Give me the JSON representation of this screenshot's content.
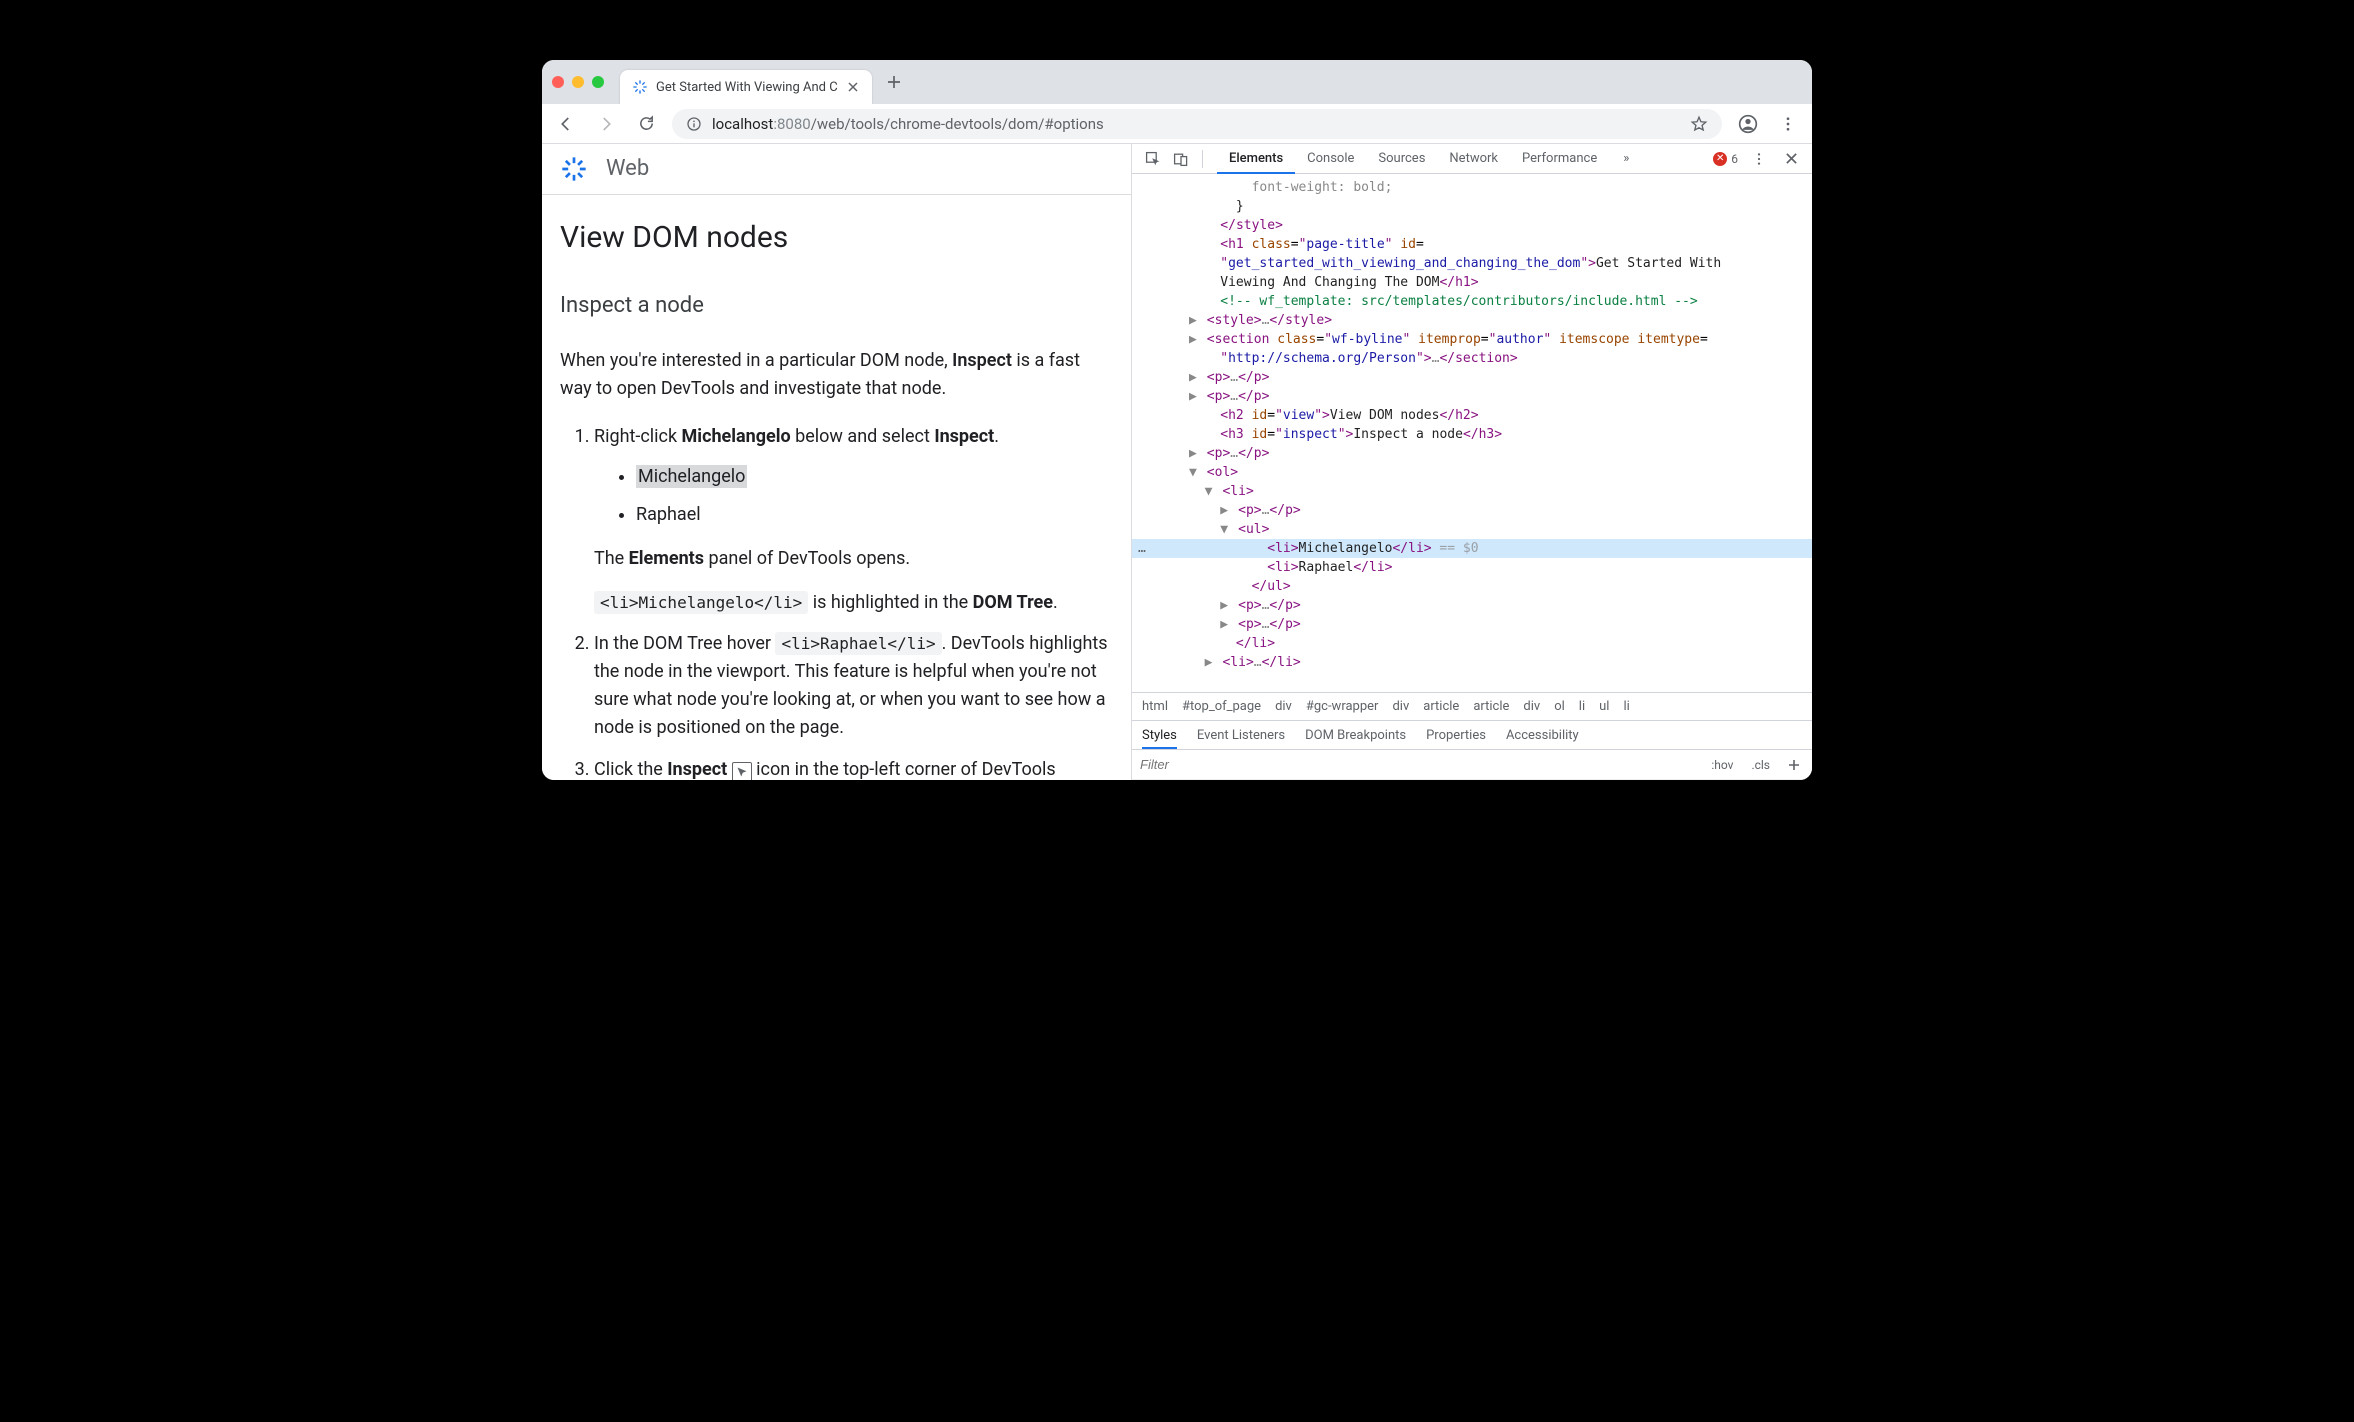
{
  "tab": {
    "title": "Get Started With Viewing And C"
  },
  "url": {
    "scheme_host": "localhost",
    "port": ":8080",
    "path": "/web/tools/chrome-devtools/dom/#options"
  },
  "site": {
    "title": "Web"
  },
  "article": {
    "h2": "View DOM nodes",
    "h3": "Inspect a node",
    "intro_a": "When you're interested in a particular DOM node, ",
    "intro_bold": "Inspect",
    "intro_b": " is a fast way to open DevTools and investigate that node.",
    "step1_a": "Right-click ",
    "step1_bold": "Michelangelo",
    "step1_b": " below and select ",
    "step1_bold2": "Inspect",
    "step1_c": ".",
    "li1": "Michelangelo",
    "li2": "Raphael",
    "elements_panel_a": "The ",
    "elements_panel_bold": "Elements",
    "elements_panel_b": " panel of DevTools opens.",
    "code1": "<li>Michelangelo</li>",
    "highlighted_a": " is highlighted in the ",
    "highlighted_bold": "DOM Tree",
    "highlighted_b": ".",
    "step2_a": "In the DOM Tree hover ",
    "code2": "<li>Raphael</li>",
    "step2_b": ". DevTools highlights the node in the viewport. This feature is helpful when you're not sure what node you're looking at, or when you want to see how a node is positioned on the page.",
    "step3_a": "Click the ",
    "step3_bold": "Inspect",
    "step3_b": " icon in the top-left corner of DevTools"
  },
  "devtools": {
    "tabs": [
      "Elements",
      "Console",
      "Sources",
      "Network",
      "Performance"
    ],
    "more": "»",
    "errors": "6",
    "tree": {
      "l0": "                font-weight: bold;",
      "l1": "              }",
      "h1_text": "Get Started With Viewing And Changing The DOM",
      "h1_class": "page-title",
      "h1_id": "get_started_with_viewing_and_changing_the_dom",
      "comment": " wf_template: src/templates/contributors/include.html ",
      "section_class": "wf-byline",
      "section_itemprop": "author",
      "section_itemtype": "http://schema.org/Person",
      "h2_id": "view",
      "h2_text": "View DOM nodes",
      "h3_id": "inspect",
      "h3_text": "Inspect a node",
      "li_mich": "Michelangelo",
      "li_raph": "Raphael",
      "eq0": " == $0"
    },
    "breadcrumbs": [
      "html",
      "#top_of_page",
      "div",
      "#gc-wrapper",
      "div",
      "article",
      "article",
      "div",
      "ol",
      "li",
      "ul",
      "li"
    ],
    "styles_tabs": [
      "Styles",
      "Event Listeners",
      "DOM Breakpoints",
      "Properties",
      "Accessibility"
    ],
    "filter": {
      "placeholder": "Filter",
      "hov": ":hov",
      "cls": ".cls"
    }
  }
}
